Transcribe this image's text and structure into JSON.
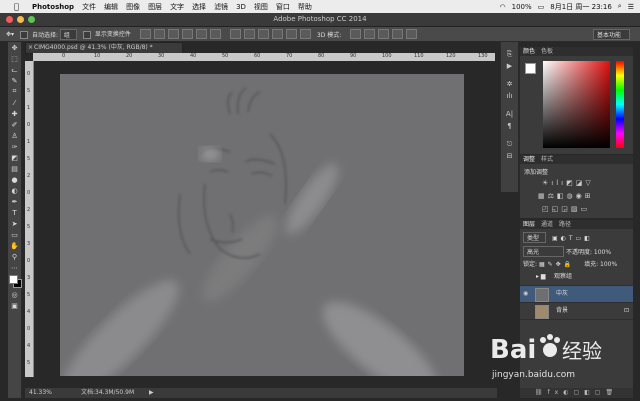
{
  "menubar": {
    "app": "Photoshop",
    "items": [
      "文件",
      "编辑",
      "图像",
      "图层",
      "文字",
      "选择",
      "滤镜",
      "3D",
      "视图",
      "窗口",
      "帮助"
    ],
    "battery": "100%",
    "datetime": "8月1日 周一 23:16"
  },
  "window": {
    "title": "Adobe Photoshop CC 2014"
  },
  "options": {
    "auto_select_label": "自动选择:",
    "auto_select_value": "组",
    "show_transform_label": "显示变换控件",
    "mode_3d_label": "3D 模式:",
    "workspace": "基本功能"
  },
  "document": {
    "tab": "CIMG4000.psd @ 41.3% (中灰, RGB/8) *",
    "zoom": "41.33%",
    "doc_info": "文档:34.3M/50.9M"
  },
  "ruler": {
    "h_ticks": [
      "0",
      "10",
      "20",
      "30",
      "40",
      "50",
      "60",
      "70",
      "80",
      "90",
      "100",
      "110",
      "120",
      "130",
      "140"
    ],
    "v_ticks": [
      "0",
      "5",
      "1",
      "0",
      "1",
      "5",
      "2",
      "0",
      "2",
      "5",
      "3",
      "0",
      "3",
      "5",
      "4",
      "0",
      "4",
      "5"
    ]
  },
  "tools": [
    "move",
    "marquee",
    "lasso",
    "quick-select",
    "crop",
    "eyedropper",
    "healing",
    "brush",
    "stamp",
    "history-brush",
    "eraser",
    "gradient",
    "blur",
    "dodge",
    "pen",
    "type",
    "path-select",
    "shape",
    "hand",
    "zoom",
    "more",
    "fg-bg-color",
    "quick-mask",
    "screen-mode"
  ],
  "color_panel": {
    "tabs": [
      "颜色",
      "色板"
    ]
  },
  "adjustments_panel": {
    "tabs": [
      "调整",
      "样式"
    ],
    "label": "添加调整"
  },
  "layers_panel": {
    "tabs": [
      "图层",
      "通道",
      "路径"
    ],
    "filter": "类型",
    "blend_mode": "高光",
    "opacity_label": "不透明度:",
    "opacity": "100%",
    "lock_label": "锁定:",
    "fill_label": "填充:",
    "fill": "100%",
    "layers": [
      {
        "name": "观察组",
        "type": "group"
      },
      {
        "name": "中灰",
        "type": "layer",
        "selected": true
      },
      {
        "name": "背景",
        "type": "background"
      }
    ]
  },
  "watermark": {
    "text": "jingyan.baidu.com"
  },
  "colors": {
    "accent": "#3f5a7a",
    "fg": "#ffffff",
    "bg": "#000000"
  }
}
